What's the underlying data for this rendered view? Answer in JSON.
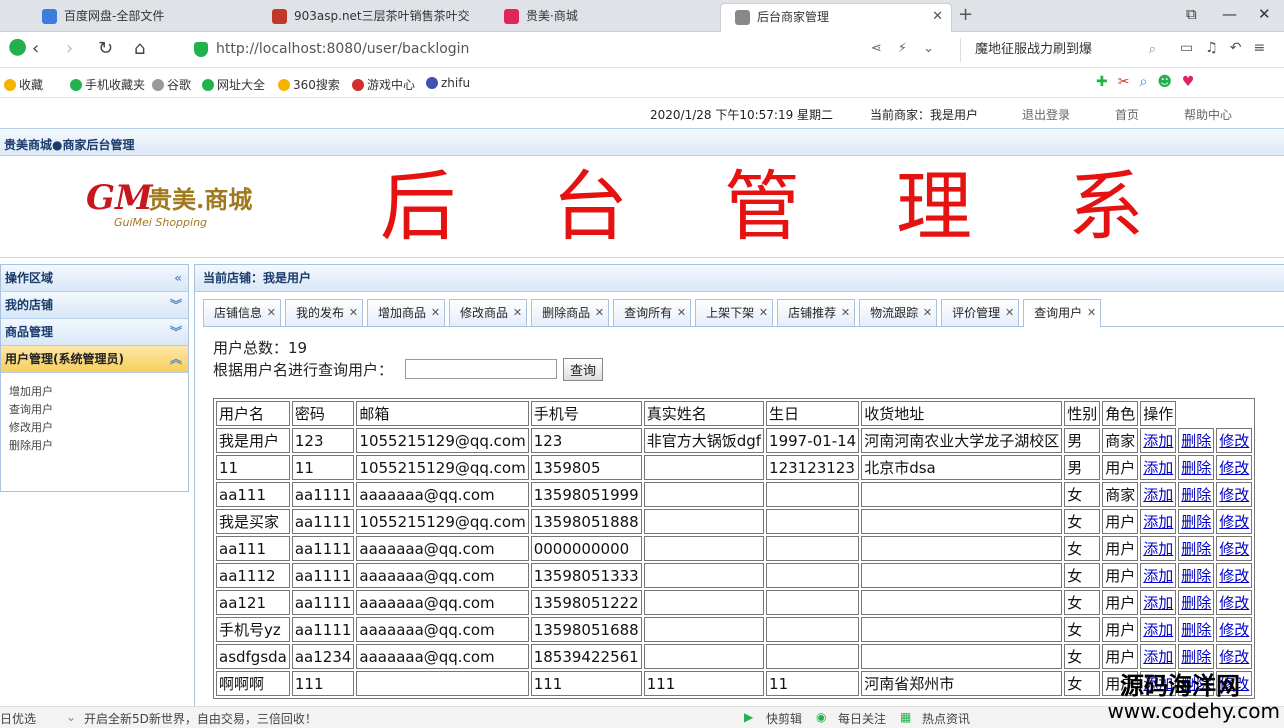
{
  "browser": {
    "tabs": [
      {
        "label": "百度网盘-全部文件",
        "color": "#3b7ddd"
      },
      {
        "label": "903asp.net三层茶叶销售茶叶交",
        "color": "#c0392b"
      },
      {
        "label": "贵美·商城",
        "color": "#e0245e"
      },
      {
        "label": "后台商家管理",
        "color": "#888888"
      }
    ],
    "url": "http://localhost:8080/user/backlogin",
    "search_text": "魔地征服战力刷到爆",
    "bookmarks": [
      {
        "label": "收藏",
        "color": "#f4b400"
      },
      {
        "label": "手机收藏夹",
        "color": "#22b14c"
      },
      {
        "label": "谷歌",
        "color": "#999999"
      },
      {
        "label": "网址大全",
        "color": "#22b14c"
      },
      {
        "label": "360搜索",
        "color": "#f4b400"
      },
      {
        "label": "游戏中心",
        "color": "#d32f2f"
      },
      {
        "label": "zhifu",
        "color": "#3f51b5"
      }
    ]
  },
  "topinfo": {
    "datetime": "2020/1/28 下午10:57:19 星期二",
    "current_merchant": "当前商家：我是用户",
    "logout": "退出登录",
    "home": "首页",
    "help": "帮助中心"
  },
  "brand_bar": "贵美商城●商家后台管理",
  "logo": {
    "mark": "GM",
    "cn": "贵美.商城",
    "en": "GuiMei Shopping"
  },
  "big_title": "后台管理系",
  "sidebar": {
    "header": "操作区域",
    "sections": [
      {
        "label": "我的店铺",
        "active": false
      },
      {
        "label": "商品管理",
        "active": false
      },
      {
        "label": "用户管理(系统管理员)",
        "active": true
      }
    ],
    "sub_items": [
      "增加用户",
      "查询用户",
      "修改用户",
      "删除用户"
    ]
  },
  "main": {
    "header": "当前店铺：我是用户",
    "tabs": [
      "店铺信息",
      "我的发布",
      "增加商品",
      "修改商品",
      "删除商品",
      "查询所有",
      "上架下架",
      "店铺推荐",
      "物流跟踪",
      "评价管理",
      "查询用户"
    ],
    "active_tab": "查询用户",
    "total_users": "用户总数：19",
    "query_label": "根据用户名进行查询用户：",
    "query_button": "查询"
  },
  "table": {
    "headers": [
      "用户名",
      "密码",
      "邮箱",
      "手机号",
      "真实姓名",
      "生日",
      "收货地址",
      "性别",
      "角色",
      "操作"
    ],
    "actions": [
      "添加",
      "删除",
      "修改"
    ],
    "rows": [
      [
        "我是用户",
        "123",
        "1055215129@qq.com",
        "123",
        "非官方大锅饭dgf",
        "1997-01-14",
        "河南河南农业大学龙子湖校区",
        "男",
        "商家"
      ],
      [
        "11",
        "11",
        "1055215129@qq.com",
        "1359805",
        "",
        "123123123",
        "北京市dsa",
        "男",
        "用户"
      ],
      [
        "aa111",
        "aa1111",
        "aaaaaaa@qq.com",
        "13598051999",
        "",
        "",
        "",
        "女",
        "商家"
      ],
      [
        "我是买家",
        "aa1111",
        "1055215129@qq.com",
        "13598051888",
        "",
        "",
        "",
        "女",
        "用户"
      ],
      [
        "aa111",
        "aa1111",
        "aaaaaaa@qq.com",
        "0000000000",
        "",
        "",
        "",
        "女",
        "用户"
      ],
      [
        "aa1112",
        "aa1111",
        "aaaaaaa@qq.com",
        "13598051333",
        "",
        "",
        "",
        "女",
        "用户"
      ],
      [
        "aa121",
        "aa1111",
        "aaaaaaa@qq.com",
        "13598051222",
        "",
        "",
        "",
        "女",
        "用户"
      ],
      [
        "手机号yz",
        "aa1111",
        "aaaaaaa@qq.com",
        "13598051688",
        "",
        "",
        "",
        "女",
        "用户"
      ],
      [
        "asdfgsda",
        "aa1234",
        "aaaaaaa@qq.com",
        "18539422561",
        "",
        "",
        "",
        "女",
        "用户"
      ],
      [
        "啊啊啊",
        "111",
        "",
        "111",
        "111",
        "11",
        "河南省郑州市",
        "女",
        "用户"
      ]
    ]
  },
  "status_bar": {
    "left": "日优选",
    "promo": "开启全新5D新世界，自由交易，三倍回收！",
    "items": [
      "快剪辑",
      "每日关注",
      "热点资讯"
    ]
  },
  "watermark": {
    "line1": "源码海洋网",
    "line2": "www.codehy.com"
  }
}
